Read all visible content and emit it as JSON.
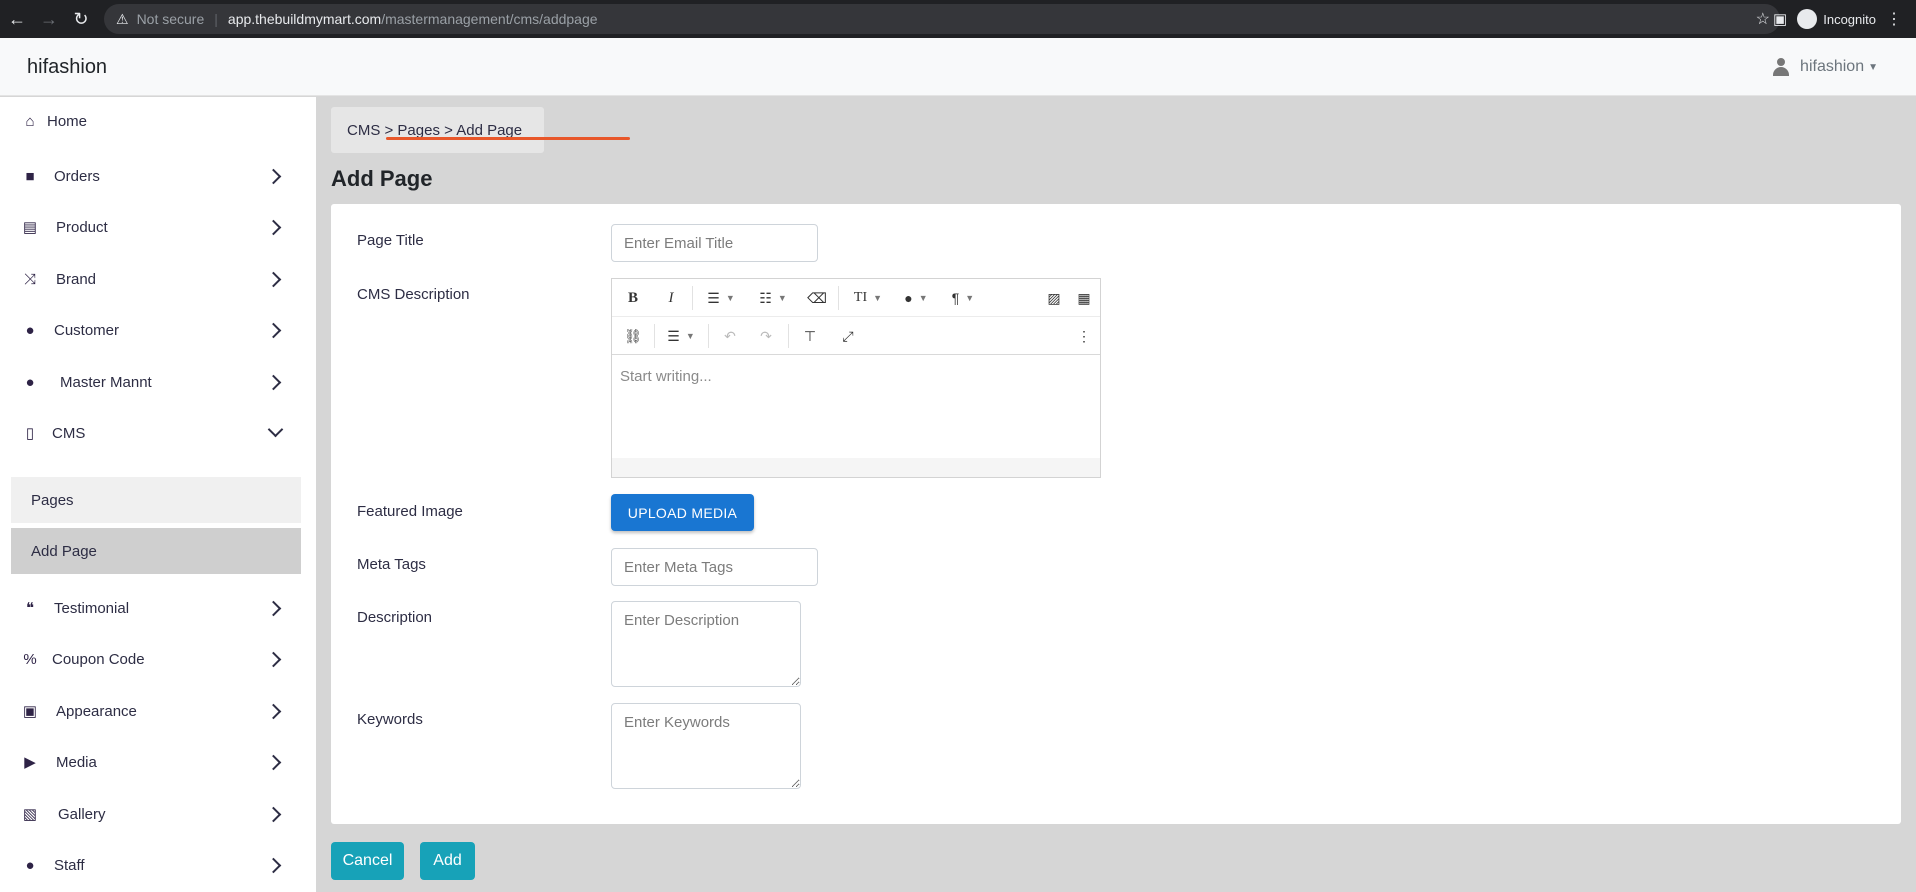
{
  "browser": {
    "security_label": "Not secure",
    "url_host": "app.thebuildmymart.com",
    "url_path": "/mastermanagement/cms/addpage",
    "profile_label": "Incognito"
  },
  "navbar": {
    "brand": "hifashion",
    "user": "hifashion"
  },
  "sidebar": {
    "items": [
      {
        "label": "Home",
        "icon": "home-icon"
      },
      {
        "label": "Orders",
        "icon": "shopping-bag-icon"
      },
      {
        "label": "Product",
        "icon": "archive-icon"
      },
      {
        "label": "Brand",
        "icon": "shuffle-icon"
      },
      {
        "label": "Customer",
        "icon": "user-icon"
      },
      {
        "label": "Master Mannt",
        "icon": "user-cog-icon"
      },
      {
        "label": "CMS",
        "icon": "file-icon"
      },
      {
        "label": "Testimonial",
        "icon": "quote-icon"
      },
      {
        "label": "Coupon Code",
        "icon": "percent-icon"
      },
      {
        "label": "Appearance",
        "icon": "image-icon"
      },
      {
        "label": "Media",
        "icon": "play-circle-icon"
      },
      {
        "label": "Gallery",
        "icon": "images-icon"
      },
      {
        "label": "Staff",
        "icon": "user-icon"
      }
    ],
    "cms_submenu": [
      "Pages",
      "Add Page"
    ]
  },
  "breadcrumb": "CMS > Pages > Add Page",
  "page_title": "Add Page",
  "form": {
    "page_title_label": "Page Title",
    "page_title_placeholder": "Enter Email Title",
    "cms_description_label": "CMS Description",
    "editor_placeholder": "Start writing...",
    "featured_image_label": "Featured Image",
    "upload_button": "UPLOAD MEDIA",
    "meta_tags_label": "Meta Tags",
    "meta_tags_placeholder": "Enter Meta Tags",
    "description_label": "Description",
    "description_placeholder": "Enter Description",
    "keywords_label": "Keywords",
    "keywords_placeholder": "Enter Keywords"
  },
  "editor_toolbar": {
    "bold": "B",
    "italic": "I",
    "font_size": "TI",
    "paragraph": "¶"
  },
  "actions": {
    "cancel": "Cancel",
    "add": "Add"
  },
  "colors": {
    "primary": "#1976d2",
    "action": "#17a2b8",
    "highlight_mark": "#e8572a"
  }
}
